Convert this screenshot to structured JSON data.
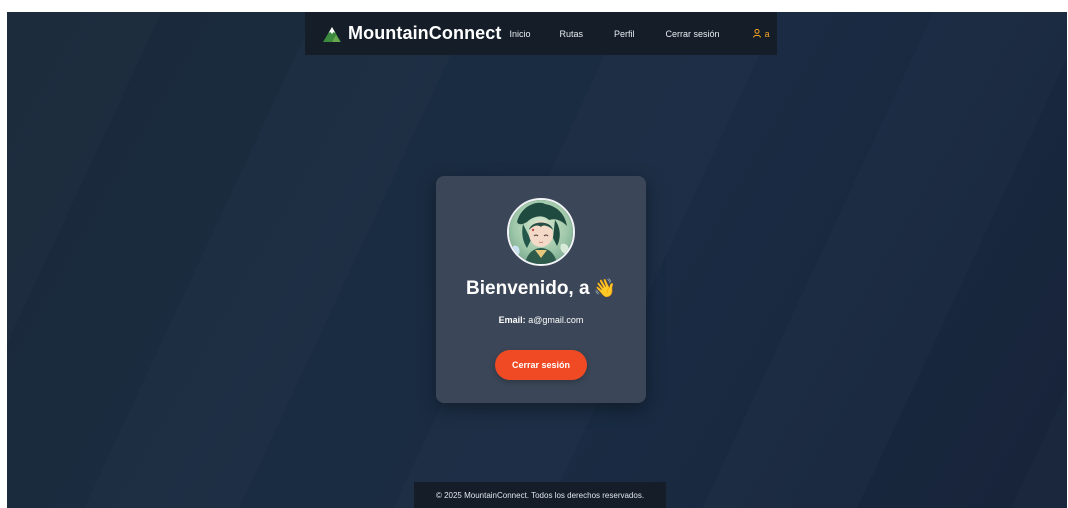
{
  "navbar": {
    "brand": "MountainConnect",
    "links": [
      "Inicio",
      "Rutas",
      "Perfil",
      "Cerrar sesión"
    ],
    "user_name": "a",
    "brand_icon": "mountain-icon",
    "user_icon": "user-icon",
    "user_color": "#f5a623"
  },
  "profile": {
    "avatar_icon": "avatar-image",
    "welcome_prefix": "Bienvenido, a",
    "wave_emoji": "👋",
    "email_label": "Email:",
    "email_value": "a@gmail.com",
    "logout_label": "Cerrar sesión",
    "button_color": "#ef4a24"
  },
  "footer": {
    "text": "© 2025 MountainConnect. Todos los derechos reservados."
  }
}
